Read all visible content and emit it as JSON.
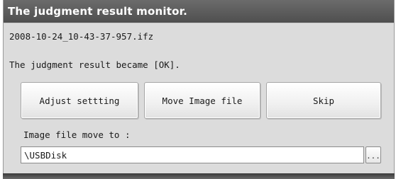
{
  "window": {
    "title": "The judgment result monitor."
  },
  "file": {
    "name": "2008-10-24_10-43-37-957.ifz"
  },
  "result": {
    "message": "The judgment result became [OK]."
  },
  "buttons": {
    "adjust_label": "Adjust settting",
    "move_label": "Move Image file",
    "skip_label": "Skip"
  },
  "destination": {
    "label": "Image file move to :",
    "path_value": "\\USBDisk",
    "browse_label": "..."
  }
}
